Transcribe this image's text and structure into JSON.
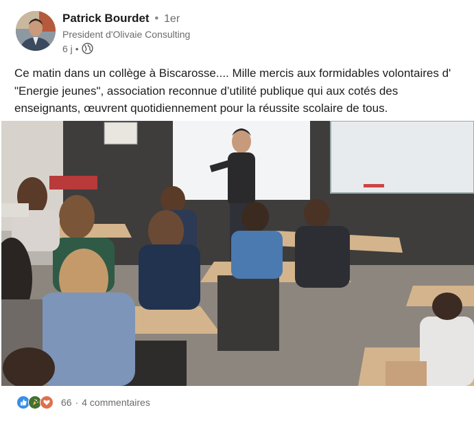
{
  "author": {
    "name": "Patrick Bourdet",
    "degree": "1er",
    "headline": "President d'Olivaie Consulting",
    "time_ago": "6 j",
    "separator": "•"
  },
  "post": {
    "text": "Ce matin dans un collège à Biscarosse.... Mille mercis aux formidables volontaires d' \"Energie jeunes\", association reconnue d’utilité publique qui aux cotés des enseignants, œuvrent quotidiennement pour la réussite scolaire de tous."
  },
  "social": {
    "reaction_icons": [
      "like-icon",
      "celebrate-icon",
      "love-icon"
    ],
    "reaction_count": "66",
    "separator": "·",
    "comments": "4 commentaires"
  },
  "colors": {
    "like": "#378fe9",
    "celebrate": "#44712e",
    "love": "#df704d"
  }
}
